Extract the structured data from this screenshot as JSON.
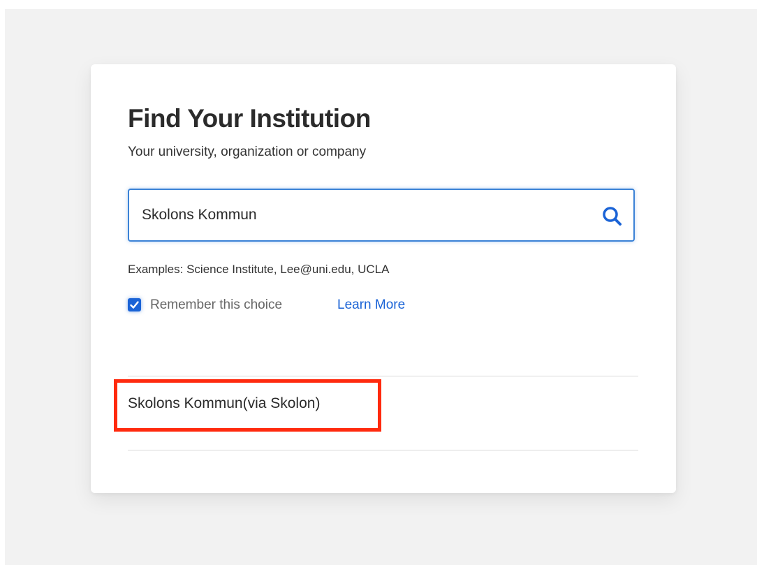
{
  "card": {
    "title": "Find Your Institution",
    "subtitle": "Your university, organization or company"
  },
  "search": {
    "value": "Skolons Kommun",
    "icon": "search-icon"
  },
  "examples_text": "Examples: Science Institute, Lee@uni.edu, UCLA",
  "remember": {
    "label": "Remember this choice",
    "checked": true,
    "learn_more_label": "Learn More"
  },
  "results": [
    {
      "label": "Skolons Kommun(via Skolon)"
    }
  ],
  "colors": {
    "accent": "#1a63d6",
    "input_border": "#3b82d6",
    "highlight": "#ff2a0e",
    "background": "#f2f2f2"
  }
}
